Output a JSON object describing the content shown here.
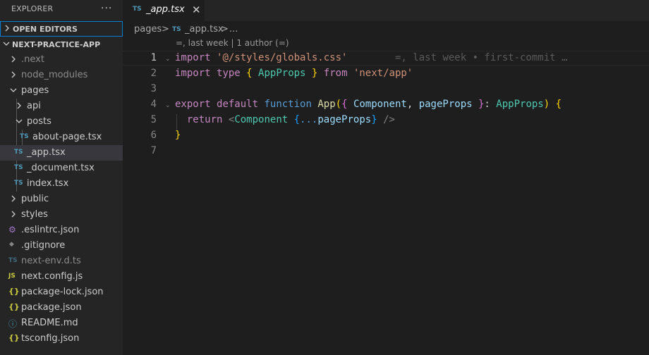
{
  "sidebar": {
    "title": "EXPLORER",
    "more": "···",
    "open_editors": "OPEN EDITORS",
    "project": "NEXT-PRACTICE-APP",
    "items": [
      {
        "name": ".next",
        "kind": "folder",
        "icon": "chevron-right-icon"
      },
      {
        "name": "node_modules",
        "kind": "folder",
        "icon": "chevron-right-icon"
      },
      {
        "name": "pages",
        "kind": "folder-open",
        "icon": "chevron-down-icon"
      },
      {
        "name": "api",
        "kind": "folder",
        "icon": "chevron-right-icon"
      },
      {
        "name": "posts",
        "kind": "folder-open",
        "icon": "chevron-down-icon"
      },
      {
        "name": "about-page.tsx",
        "kind": "file",
        "badge": "TS"
      },
      {
        "name": "_app.tsx",
        "kind": "file",
        "badge": "TS",
        "selected": true
      },
      {
        "name": "_document.tsx",
        "kind": "file",
        "badge": "TS"
      },
      {
        "name": "index.tsx",
        "kind": "file",
        "badge": "TS"
      },
      {
        "name": "public",
        "kind": "folder",
        "icon": "chevron-right-icon"
      },
      {
        "name": "styles",
        "kind": "folder",
        "icon": "chevron-right-icon"
      },
      {
        "name": ".eslintrc.json",
        "kind": "file",
        "badge": "⚙"
      },
      {
        "name": ".gitignore",
        "kind": "file",
        "badge": "◆"
      },
      {
        "name": "next-env.d.ts",
        "kind": "file",
        "badge": "TS"
      },
      {
        "name": "next.config.js",
        "kind": "file",
        "badge": "JS"
      },
      {
        "name": "package-lock.json",
        "kind": "file",
        "badge": "{}"
      },
      {
        "name": "package.json",
        "kind": "file",
        "badge": "{}"
      },
      {
        "name": "README.md",
        "kind": "file",
        "badge": "ⓘ"
      },
      {
        "name": "tsconfig.json",
        "kind": "file",
        "badge": "{}"
      }
    ]
  },
  "tab": {
    "badge": "TS",
    "label": "_app.tsx",
    "close": "✕"
  },
  "breadcrumb": {
    "folder": "pages",
    "sep1": ">",
    "badge": "TS",
    "file": "_app.tsx",
    "sep2": ">",
    "more": "..."
  },
  "codelens": "=, last week | 1 author (=)",
  "blame": "=, last week • first-commit …",
  "editor": {
    "line_numbers": [
      "1",
      "2",
      "3",
      "4",
      "5",
      "6",
      "7"
    ],
    "code": {
      "l1_kw": "import",
      "l1_str": "'@/styles/globals.css'",
      "l2_kw": "import",
      "l2_type": "type",
      "l2_open": "{",
      "l2_name": "AppProps",
      "l2_close": "}",
      "l2_from": "from",
      "l2_str": "'next/app'",
      "l4_export": "export",
      "l4_default": "default",
      "l4_function": "function",
      "l4_fn": "App",
      "l4_paren": "(",
      "l4_ob": "{",
      "l4_comp": "Component",
      "l4_comma": ",",
      "l4_props": "pageProps",
      "l4_cb": "}",
      "l4_colon": ":",
      "l4_type": "AppProps",
      "l4_cp": ")",
      "l4_brace": "{",
      "l5_return": "return",
      "l5_lt": "<",
      "l5_comp": "Component",
      "l5_ob": "{",
      "l5_spread": "...",
      "l5_props": "pageProps",
      "l5_cb": "}",
      "l5_end": "/>",
      "l6_brace": "}"
    }
  }
}
